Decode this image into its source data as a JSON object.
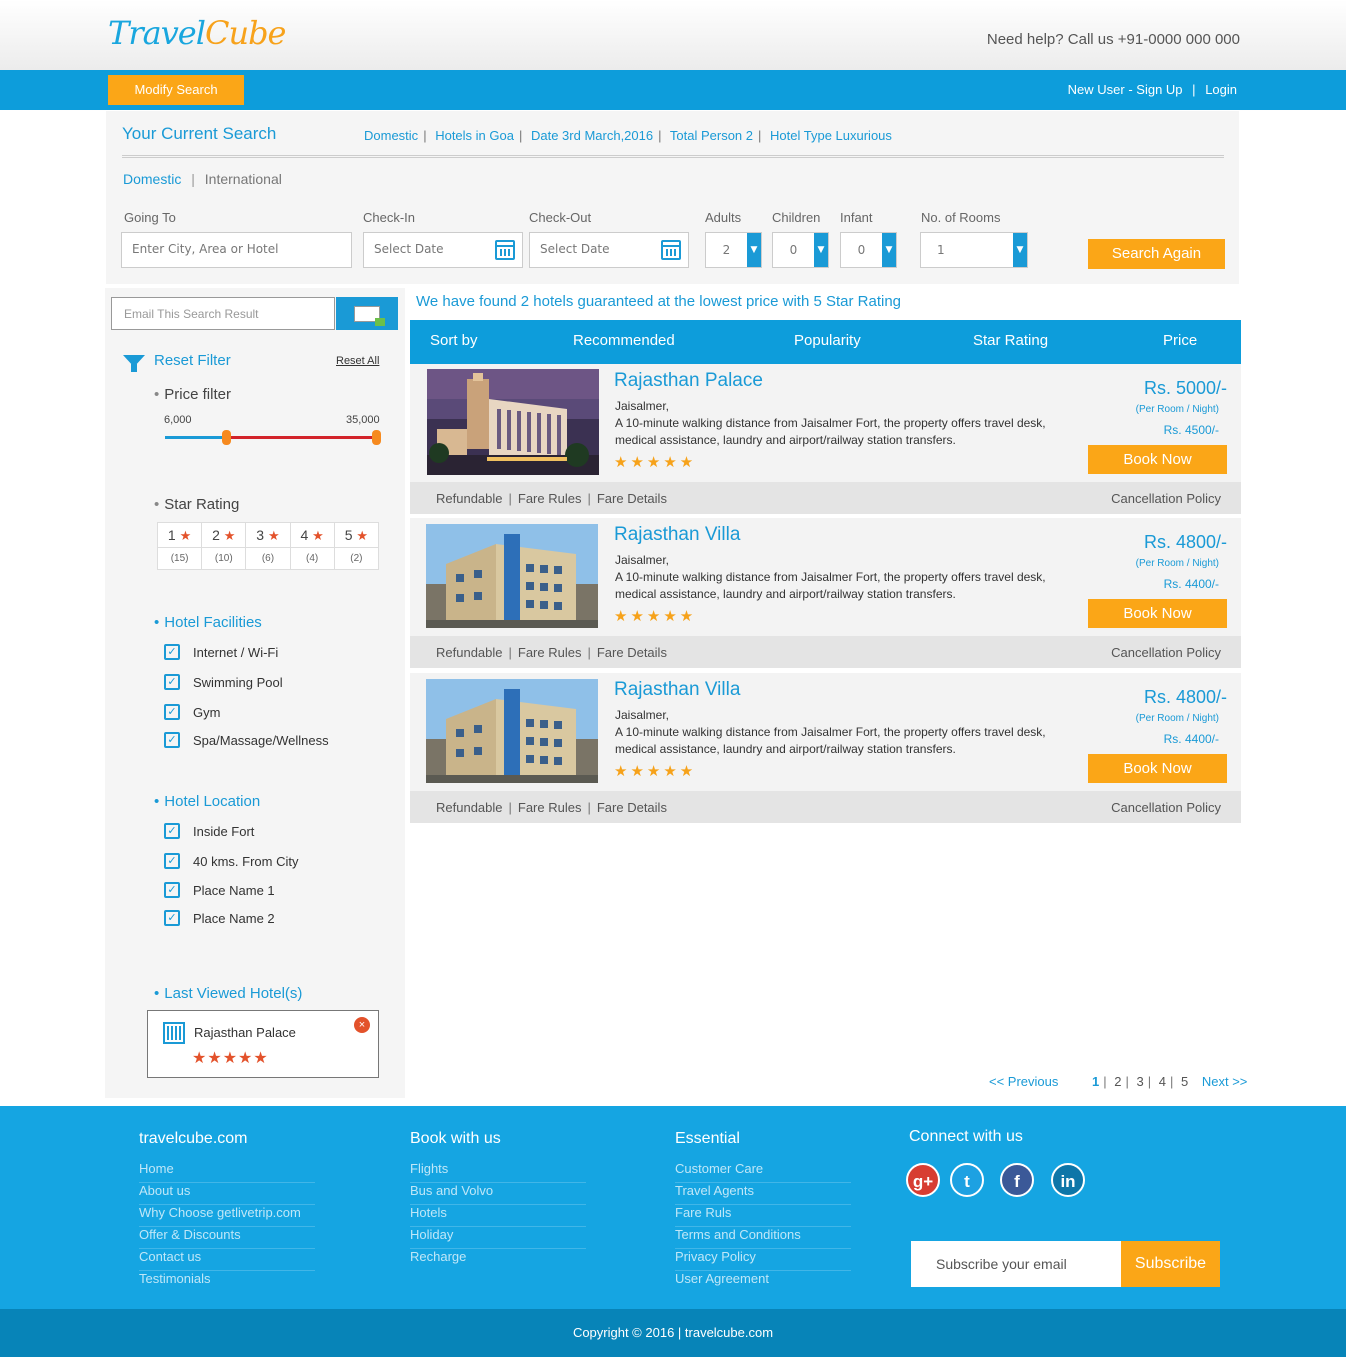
{
  "header": {
    "logo_part1": "Travel",
    "logo_part2": "Cube",
    "help_text": "Need help? Call us +91-0000 000 000",
    "modify_search": "Modify Search",
    "signup": "New User - Sign Up",
    "separator": "|",
    "login": "Login"
  },
  "current_search": {
    "title": "Your Current Search",
    "items": [
      "Domestic",
      "Hotels in Goa",
      "Date 3rd March,2016",
      "Total Person 2",
      "Hotel Type Luxurious"
    ],
    "tab_domestic": "Domestic",
    "tab_international": "International",
    "labels": {
      "going_to": "Going To",
      "check_in": "Check-In",
      "check_out": "Check-Out",
      "adults": "Adults",
      "children": "Children",
      "infant": "Infant",
      "rooms": "No. of Rooms"
    },
    "going_to_placeholder": "Enter City, Area or Hotel",
    "check_in_placeholder": "Select Date",
    "check_out_placeholder": "Select Date",
    "adults": "2",
    "children": "0",
    "infant": "0",
    "rooms": "1",
    "search_again": "Search Again"
  },
  "sidebar": {
    "email_placeholder": "Email This Search Result",
    "reset_filter": "Reset Filter",
    "reset_all": "Reset All",
    "price_filter": "Price filter",
    "price_min": "6,000",
    "price_max": "35,000",
    "price_selected_fraction": [
      0.29,
      1.0
    ],
    "star_rating_title": "Star Rating",
    "star_ratings": [
      {
        "label": "1",
        "count": "(15)"
      },
      {
        "label": "2",
        "count": "(10)"
      },
      {
        "label": "3",
        "count": "(6)"
      },
      {
        "label": "4",
        "count": "(4)"
      },
      {
        "label": "5",
        "count": "(2)"
      }
    ],
    "star_symbol": "★",
    "facilities_title": "Hotel Facilities",
    "facilities": [
      "Internet / Wi-Fi",
      "Swimming Pool",
      "Gym",
      "Spa/Massage/Wellness"
    ],
    "location_title": "Hotel Location",
    "locations": [
      "Inside Fort",
      "40 kms. From City",
      "Place Name 1",
      "Place Name 2"
    ],
    "last_viewed_title": "Last Viewed Hotel(s)",
    "last_viewed_name": "Rajasthan Palace",
    "last_viewed_stars": "★★★★★",
    "close": "×"
  },
  "results": {
    "found_text": "We have found 2 hotels guaranteed at the lowest price with 5 Star Rating",
    "sort": [
      "Sort by",
      "Recommended",
      "Popularity",
      "Star Rating",
      "Price"
    ],
    "hotels": [
      {
        "name": "Rajasthan Palace",
        "city": "Jaisalmer,",
        "desc": "A 10-minute walking distance from Jaisalmer Fort, the property offers travel desk, medical assistance, laundry and airport/railway station transfers.",
        "stars": "★★★★★",
        "price": "Rs. 5000/-",
        "per": "(Per Room / Night)",
        "disc": "Rs. 4500/-",
        "book": "Book Now",
        "refundable": "Refundable",
        "fare_rules": "Fare Rules",
        "fare_details": "Fare Details",
        "cancel": "Cancellation Policy"
      },
      {
        "name": "Rajasthan Villa",
        "city": "Jaisalmer,",
        "desc": "A 10-minute walking distance from Jaisalmer Fort, the property offers travel desk, medical assistance, laundry and airport/railway station transfers.",
        "stars": "★★★★★",
        "price": "Rs. 4800/-",
        "per": "(Per Room / Night)",
        "disc": "Rs. 4400/-",
        "book": "Book Now",
        "refundable": "Refundable",
        "fare_rules": "Fare Rules",
        "fare_details": "Fare Details",
        "cancel": "Cancellation Policy"
      },
      {
        "name": "Rajasthan Villa",
        "city": "Jaisalmer,",
        "desc": "A 10-minute walking distance from Jaisalmer Fort, the property offers travel desk, medical assistance, laundry and airport/railway station transfers.",
        "stars": "★★★★★",
        "price": "Rs. 4800/-",
        "per": "(Per Room / Night)",
        "disc": "Rs. 4400/-",
        "book": "Book Now",
        "refundable": "Refundable",
        "fare_rules": "Fare Rules",
        "fare_details": "Fare Details",
        "cancel": "Cancellation Policy"
      }
    ],
    "pager": {
      "prev": "<<  Previous",
      "pages": [
        "1",
        "2",
        "3",
        "4",
        "5"
      ],
      "next": "Next  >>"
    }
  },
  "footer": {
    "col1_title": "travelcube.com",
    "col1": [
      "Home",
      "About us",
      "Why Choose getlivetrip.com",
      "Offer & Discounts",
      "Contact us",
      "Testimonials"
    ],
    "col2_title": "Book with us",
    "col2": [
      "Flights",
      "Bus and Volvo",
      "Hotels",
      "Holiday",
      "Recharge"
    ],
    "col3_title": "Essential",
    "col3": [
      "Customer Care",
      "Travel Agents",
      "Fare Ruls",
      "Terms and Conditions",
      "Privacy Policy",
      "User Agreement"
    ],
    "connect_title": "Connect with us",
    "social": [
      {
        "icon": "google-plus-icon",
        "glyph": "g+",
        "color": "#d73d32"
      },
      {
        "icon": "twitter-icon",
        "glyph": "t",
        "color": "#1da1e2"
      },
      {
        "icon": "facebook-icon",
        "glyph": "f",
        "color": "#3b5998"
      },
      {
        "icon": "linkedin-icon",
        "glyph": "in",
        "color": "#0e76a8"
      }
    ],
    "subscribe_placeholder": "Subscribe your email",
    "subscribe_button": "Subscribe",
    "copyright": "Copyright © 2016  |  travelcube.com"
  },
  "colors": {
    "accent": "#0d9ddb",
    "orange": "#fba617",
    "star": "#f6a21a",
    "red": "#d2232a"
  }
}
